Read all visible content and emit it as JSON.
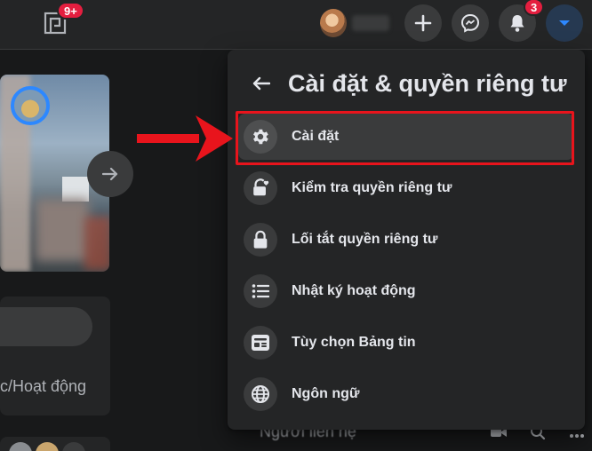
{
  "topbar": {
    "gaming_badge": "9+",
    "notification_badge": "3",
    "icons": [
      "gaming-icon",
      "plus-icon",
      "messenger-icon",
      "bell-icon",
      "caret-down-icon"
    ]
  },
  "feed": {
    "composer_action": "c/Hoạt động"
  },
  "contacts": {
    "label": "Người liên hệ"
  },
  "menu": {
    "title": "Cài đặt & quyền riêng tư",
    "items": [
      {
        "label": "Cài đặt",
        "icon": "gear-icon"
      },
      {
        "label": "Kiểm tra quyền riêng tư",
        "icon": "lock-heart-icon"
      },
      {
        "label": "Lối tắt quyền riêng tư",
        "icon": "lock-icon"
      },
      {
        "label": "Nhật ký hoạt động",
        "icon": "list-icon"
      },
      {
        "label": "Tùy chọn Bảng tin",
        "icon": "feed-icon"
      },
      {
        "label": "Ngôn ngữ",
        "icon": "globe-icon"
      }
    ]
  },
  "colors": {
    "background": "#18191a",
    "surface": "#242526",
    "accent": "#2d88ff",
    "badge": "#e41e3f",
    "annotation": "#e8141c"
  }
}
